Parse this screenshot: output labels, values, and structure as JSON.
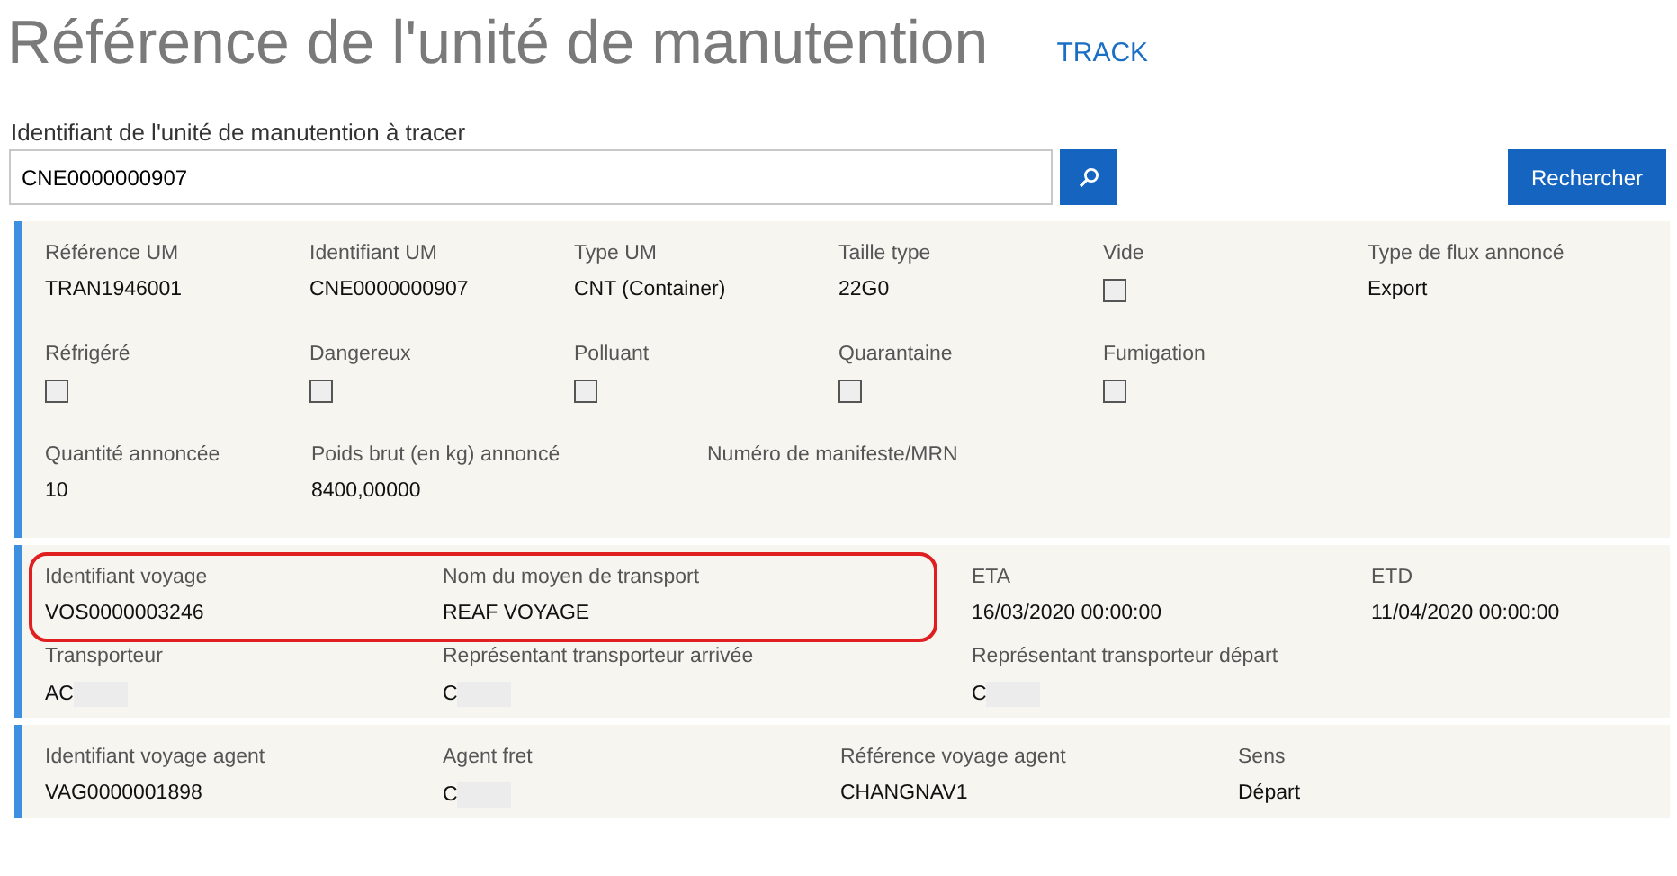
{
  "title": "Référence de l'unité de manutention",
  "track_link": "TRACK",
  "search": {
    "label": "Identifiant de l'unité de manutention à tracer",
    "value": "CNE0000000907",
    "button": "Rechercher"
  },
  "sections": [
    {
      "rows": [
        {
          "fields": [
            {
              "kind": "text",
              "label": "Référence UM",
              "value": "TRAN1946001"
            },
            {
              "kind": "text",
              "label": "Identifiant UM",
              "value": "CNE0000000907"
            },
            {
              "kind": "text",
              "label": "Type UM",
              "value": "CNT (Container)"
            },
            {
              "kind": "text",
              "label": "Taille type",
              "value": "22G0"
            },
            {
              "kind": "checkbox",
              "label": "Vide",
              "checked": false
            },
            {
              "kind": "text",
              "label": "Type de flux annoncé",
              "value": "Export"
            }
          ]
        },
        {
          "fields": [
            {
              "kind": "checkbox",
              "label": "Réfrigéré",
              "checked": false
            },
            {
              "kind": "checkbox",
              "label": "Dangereux",
              "checked": false
            },
            {
              "kind": "checkbox",
              "label": "Polluant",
              "checked": false
            },
            {
              "kind": "checkbox",
              "label": "Quarantaine",
              "checked": false
            },
            {
              "kind": "checkbox",
              "label": "Fumigation",
              "checked": false
            }
          ]
        },
        {
          "fields": [
            {
              "kind": "text",
              "label": "Quantité annoncée",
              "value": "10"
            },
            {
              "kind": "text",
              "label": "Poids brut (en kg) annoncé",
              "value": "8400,00000"
            },
            {
              "kind": "text",
              "label": "Numéro de manifeste/MRN"
            }
          ]
        }
      ]
    },
    {
      "rows": [
        {
          "fields": [
            {
              "kind": "text",
              "label": "Identifiant voyage",
              "value": "VOS0000003246",
              "circled": true
            },
            {
              "kind": "text",
              "label": "Nom du moyen de transport",
              "value": "REAF VOYAGE",
              "circled": true
            },
            {
              "kind": "text",
              "label": "ETA",
              "value": "16/03/2020 00:00:00"
            },
            {
              "kind": "text",
              "label": "ETD",
              "value": "11/04/2020 00:00:00"
            }
          ]
        },
        {
          "fields": [
            {
              "kind": "text",
              "label": "Transporteur",
              "value": "AC",
              "redacted": true
            },
            {
              "kind": "text",
              "label": "Représentant transporteur arrivée",
              "value": "C",
              "redacted": true
            },
            {
              "kind": "text",
              "label": "Représentant transporteur départ",
              "value": "C",
              "redacted": true
            }
          ]
        }
      ]
    },
    {
      "rows": [
        {
          "fields": [
            {
              "kind": "text",
              "label": "Identifiant voyage agent",
              "value": "VAG0000001898"
            },
            {
              "kind": "text",
              "label": "Agent fret",
              "value": "C",
              "redacted": true
            },
            {
              "kind": "text",
              "label": "Référence voyage agent",
              "value": "CHANGNAV1"
            },
            {
              "kind": "text",
              "label": "Sens",
              "value": "Départ"
            }
          ]
        }
      ]
    }
  ]
}
